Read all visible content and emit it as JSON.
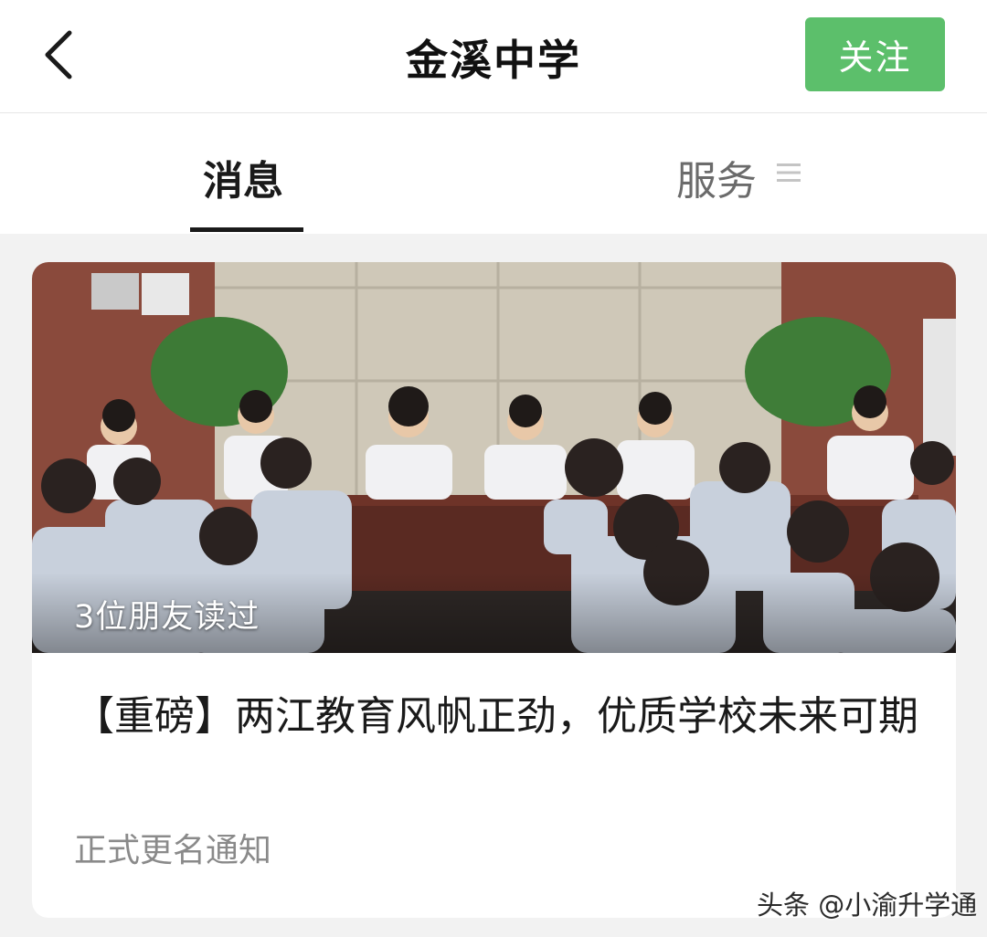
{
  "header": {
    "back_icon": "chevron-left-icon",
    "title": "金溪中学",
    "follow_label": "关注",
    "follow_color": "#5cbf6b"
  },
  "tabs": [
    {
      "label": "消息",
      "active": true
    },
    {
      "label": "服务",
      "active": false,
      "icon": "menu-icon"
    }
  ],
  "article": {
    "image_desc_icon": "meeting-photo",
    "read_badge": "3位朋友读过",
    "headline": "【重磅】两江教育风帆正劲，优质学校未来可期",
    "subtitle": "正式更名通知"
  },
  "watermark": "头条 @小渝升学通"
}
